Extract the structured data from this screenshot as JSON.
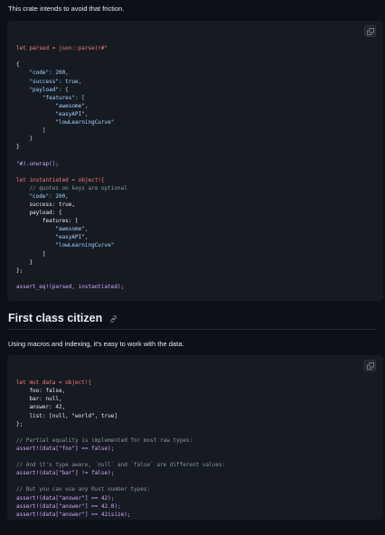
{
  "intro_text": "This crate intends to avoid that friction.",
  "code_block_1": [
    [
      [
        "let parsed = json::parse(r#\"",
        "k"
      ]
    ],
    [
      [
        "",
        ""
      ]
    ],
    [
      [
        "{",
        ""
      ]
    ],
    [
      [
        "    \"code\": 200,",
        "s"
      ]
    ],
    [
      [
        "    \"success\": true,",
        "s"
      ]
    ],
    [
      [
        "    \"payload\": {",
        "s"
      ]
    ],
    [
      [
        "        \"features\": [",
        "s"
      ]
    ],
    [
      [
        "            \"awesome\",",
        "s"
      ]
    ],
    [
      [
        "            \"easyAPI\",",
        "s"
      ]
    ],
    [
      [
        "            \"lowLearningCurve\"",
        "s"
      ]
    ],
    [
      [
        "        ]",
        "s"
      ]
    ],
    [
      [
        "    }",
        "s"
      ]
    ],
    [
      [
        "}",
        ""
      ]
    ],
    [
      [
        "",
        ""
      ]
    ],
    [
      [
        "\"#).unwrap();",
        "f"
      ]
    ],
    [
      [
        "",
        ""
      ]
    ],
    [
      [
        "let instantiated = object!{",
        "k"
      ]
    ],
    [
      [
        "    // quotes on keys are optional",
        "c"
      ]
    ],
    [
      [
        "    \"code\": 200,",
        "s"
      ]
    ],
    [
      [
        "    success: true,",
        ""
      ]
    ],
    [
      [
        "    payload: {",
        ""
      ]
    ],
    [
      [
        "        features: [",
        ""
      ]
    ],
    [
      [
        "            \"awesome\",",
        "s"
      ]
    ],
    [
      [
        "            \"easyAPI\",",
        "s"
      ]
    ],
    [
      [
        "            \"lowLearningCurve\"",
        "s"
      ]
    ],
    [
      [
        "        ]",
        ""
      ]
    ],
    [
      [
        "    }",
        ""
      ]
    ],
    [
      [
        "};",
        ""
      ]
    ],
    [
      [
        "",
        ""
      ]
    ],
    [
      [
        "assert_eq!(parsed, instantiated);",
        "f"
      ]
    ]
  ],
  "section_heading": "First class citizen",
  "section_text": "Using macros and indexing, it's easy to work with the data.",
  "code_block_2": [
    [
      [
        "let mut data = object!{",
        "k"
      ]
    ],
    [
      [
        "    foo: false,",
        ""
      ]
    ],
    [
      [
        "    bar: null,",
        ""
      ]
    ],
    [
      [
        "    answer: 42,",
        ""
      ]
    ],
    [
      [
        "    list: [null, \"world\", true]",
        ""
      ]
    ],
    [
      [
        "};",
        ""
      ]
    ],
    [
      [
        "",
        ""
      ]
    ],
    [
      [
        "// Partial equality is implemented for most raw types:",
        "c"
      ]
    ],
    [
      [
        "assert!(data[\"foo\"] == false);",
        "f"
      ]
    ],
    [
      [
        "",
        ""
      ]
    ],
    [
      [
        "// And it's type aware, `null` and `false` are different values:",
        "c"
      ]
    ],
    [
      [
        "assert!(data[\"bar\"] != false);",
        "f"
      ]
    ],
    [
      [
        "",
        ""
      ]
    ],
    [
      [
        "// But you can use any Rust number types:",
        "c"
      ]
    ],
    [
      [
        "assert!(data[\"answer\"] == 42);",
        "f"
      ]
    ],
    [
      [
        "assert!(data[\"answer\"] == 42.0);",
        "f"
      ]
    ],
    [
      [
        "assert!(data[\"answer\"] == 42isize);",
        "f"
      ]
    ]
  ]
}
